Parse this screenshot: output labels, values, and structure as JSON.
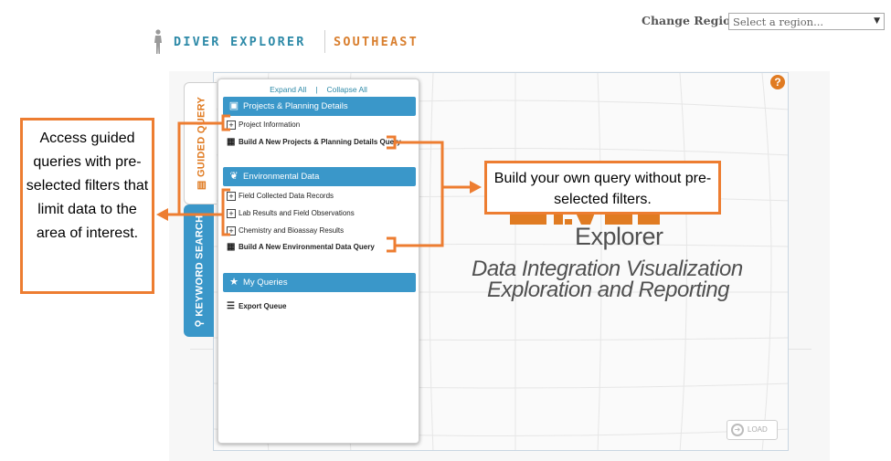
{
  "header": {
    "brand_name": "DIVER EXPLORER",
    "brand_region": "SOUTHEAST",
    "region_label": "Change Region:",
    "region_placeholder": "Select a region..."
  },
  "tabs": {
    "guided": "GUIDED QUERY",
    "keyword": "KEYWORD SEARCH"
  },
  "panel": {
    "expand_all": "Expand All",
    "separator": "|",
    "collapse_all": "Collapse All",
    "sections": [
      {
        "title": "Projects & Planning Details",
        "icon": "document-icon",
        "items": [
          {
            "label": "Project Information",
            "icon": "plus-box-icon"
          },
          {
            "label": "Build A New Projects & Planning Details Query",
            "icon": "build-query-icon"
          }
        ]
      },
      {
        "title": "Environmental Data",
        "icon": "leaf-icon",
        "items": [
          {
            "label": "Field Collected Data Records",
            "icon": "plus-box-icon"
          },
          {
            "label": "Lab Results and Field Observations",
            "icon": "plus-box-icon"
          },
          {
            "label": "Chemistry and Bioassay Results",
            "icon": "plus-box-icon"
          },
          {
            "label": "Build A New Environmental Data Query",
            "icon": "build-query-icon"
          }
        ]
      },
      {
        "title": "My Queries",
        "icon": "star-icon",
        "items": [
          {
            "label": "Export Queue",
            "icon": "list-icon"
          }
        ]
      }
    ]
  },
  "map": {
    "logo_word": "Explorer",
    "tagline_line1": "Data Integration Visualization",
    "tagline_line2": "Exploration and Reporting",
    "load_button": "LOAD",
    "help": "?"
  },
  "callouts": {
    "left": "Access guided queries with pre-selected filters that limit data to the area of interest.",
    "right": "Build your own query without pre-selected filters."
  },
  "colors": {
    "accent_blue": "#3a97c9",
    "accent_orange": "#e07b22",
    "callout_orange": "#ed7d31"
  }
}
